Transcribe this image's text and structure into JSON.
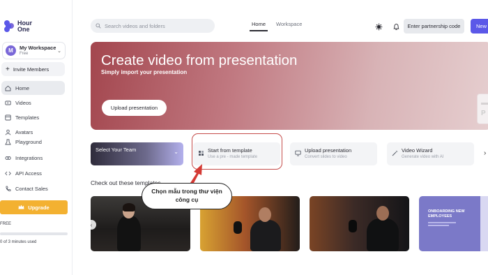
{
  "brand": {
    "logo_text": "Hour One",
    "accent": "#5b58e8"
  },
  "workspace": {
    "avatar_letter": "M",
    "name": "My Workspace",
    "plan": "Free"
  },
  "sidebar": {
    "invite_label": "Invite Members",
    "items": [
      {
        "label": "Home",
        "icon": "home-icon",
        "active": true
      },
      {
        "label": "Videos",
        "icon": "video-icon",
        "active": false
      },
      {
        "label": "Templates",
        "icon": "templates-icon",
        "active": false
      },
      {
        "label": "Avatars",
        "icon": "avatar-icon",
        "active": false
      },
      {
        "label": "Playground",
        "icon": "playground-icon",
        "active": false
      },
      {
        "label": "Integrations",
        "icon": "integrations-icon",
        "active": false
      },
      {
        "label": "API Access",
        "icon": "code-icon",
        "active": false
      },
      {
        "label": "Contact Sales",
        "icon": "phone-icon",
        "active": false
      }
    ],
    "upgrade_label": "Upgrade",
    "plan_label": "FREE",
    "usage_text": "0 of 3 minutes used",
    "usage_fraction": 0
  },
  "topbar": {
    "search_placeholder": "Search videos and folders",
    "tabs": [
      {
        "label": "Home",
        "active": true
      },
      {
        "label": "Workspace",
        "active": false
      }
    ],
    "partnership_label": "Enter partnership code",
    "new_label": "New"
  },
  "hero": {
    "title": "Create video from presentation",
    "subtitle": "Simply import your presentation",
    "button_label": "Upload presentation",
    "device_letter": "P"
  },
  "quick_actions": {
    "team_label": "Select Your Team",
    "cards": [
      {
        "title": "Start from template",
        "subtitle": "Use a pre - made template",
        "icon": "template-grid-icon"
      },
      {
        "title": "Upload presentation",
        "subtitle": "Convert slides to video",
        "icon": "monitor-icon"
      },
      {
        "title": "Video Wizard",
        "subtitle": "Generate video with AI",
        "icon": "magic-wand-icon"
      }
    ]
  },
  "templates": {
    "section_title": "Check out these templates",
    "t4_title": "ONBOARDING NEW EMPLOYEES"
  },
  "annotation": {
    "text_line1": "Chọn mẫu trong thư viện",
    "text_line2": "công cụ",
    "arrow_color": "#d43a34",
    "box_color": "#c44a48"
  }
}
